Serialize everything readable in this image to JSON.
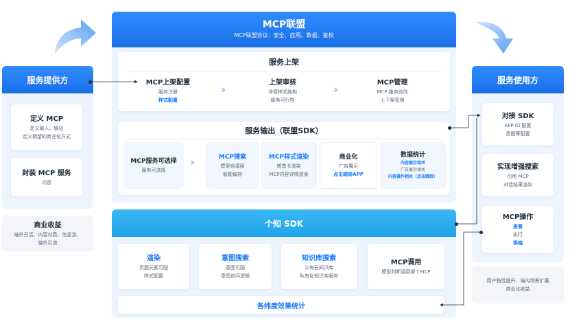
{
  "mcp_union": {
    "title": "MCP联盟",
    "subtitle": "MCP联盟协议：安全、应用、数据、鉴权"
  },
  "service_listing": {
    "title": "服务上架",
    "steps": [
      {
        "title": "MCP上架配置",
        "lines": [
          "服务注册"
        ],
        "blue": "样式配置"
      },
      {
        "title": "上架审核",
        "lines": [
          "详情样式结构",
          "服务可行性"
        ]
      },
      {
        "title": "MCP管理",
        "lines": [
          "MCP 服务修改",
          "上下架管理"
        ]
      }
    ]
  },
  "service_output": {
    "title": "服务输出（联盟SDK）",
    "selectable": {
      "title": "MCP服务可选择",
      "line": "服务可选择"
    },
    "search": {
      "title": "MCP搜索",
      "lines": [
        "模型自调用",
        "智能编排"
      ]
    },
    "style_render": {
      "title": "MCP样式渲染",
      "lines": [
        "核态卡渲染",
        "MCP内容详情渲染"
      ]
    },
    "commerce": {
      "title": "商业化",
      "line": "广告展示",
      "blue": "点击跳转APP"
    },
    "stats": {
      "title": "数据统计",
      "blue1": "内容展示相关",
      "line": "广告展示相关",
      "blue2": "内容操作相关（点击跳转）"
    }
  },
  "sdk": {
    "title": "个知 SDK",
    "cards": [
      {
        "title": "渲染",
        "lines": [
          "页面元素可配",
          "样式配置"
        ]
      },
      {
        "title": "意图搜索",
        "lines": [
          "意图可配",
          "意图追问逻辑"
        ]
      },
      {
        "title": "知识库搜索",
        "lines": [
          "公有云知识库",
          "私有化知识库服务"
        ]
      },
      {
        "title": "MCP调用",
        "lines": [
          "模型判断调用哪个MCP"
        ]
      }
    ],
    "footer": "各纬度效果统计"
  },
  "provider": {
    "title": "服务提供方",
    "cards": [
      {
        "title": "定义 MCP",
        "lines": [
          "定义输入、输出",
          "定义期望的商业化方式"
        ]
      },
      {
        "title": "封装 MCP 服务",
        "lines": [
          "内容"
        ]
      }
    ],
    "revenue": {
      "title": "商业收益",
      "lines": [
        "端外日活、内容付费、信息流、",
        "端外引流"
      ]
    }
  },
  "consumer": {
    "title": "服务使用方",
    "cards": [
      {
        "title": "对接 SDK",
        "lines": [
          "APP ID 配置",
          "意图等配置"
        ]
      },
      {
        "title": "实现增强搜索",
        "lines": [
          "引用 MCP",
          "对话结果渲染"
        ]
      },
      {
        "title": "MCP操作",
        "blue1": "查看",
        "line": "执行",
        "blue2": "换端"
      }
    ],
    "footer_lines": [
      "用户粘性提升、端内场景扩展",
      "商业化收益"
    ]
  },
  "colors": {
    "primary": "#1a6fe6",
    "cyan": "#1fa3ea",
    "panel_bg": "#edf4fd",
    "accent_text": "#1677ff"
  }
}
